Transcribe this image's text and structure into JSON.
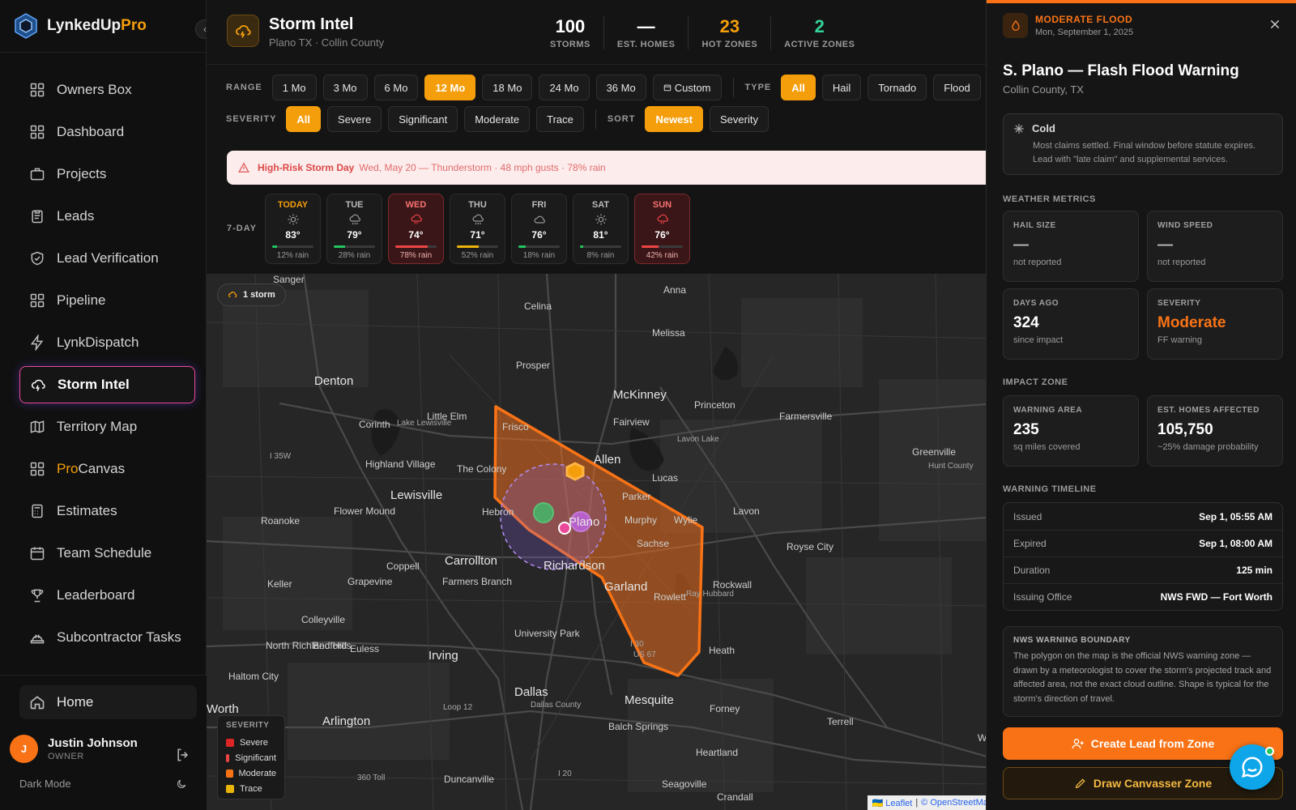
{
  "app": {
    "name_main": "LynkedUp",
    "name_accent": "Pro"
  },
  "sidebar": {
    "items": [
      {
        "label": "Owners Box",
        "icon": "grid-icon"
      },
      {
        "label": "Dashboard",
        "icon": "grid-icon"
      },
      {
        "label": "Projects",
        "icon": "briefcase-icon"
      },
      {
        "label": "Leads",
        "icon": "clipboard-icon"
      },
      {
        "label": "Lead Verification",
        "icon": "shield-check-icon"
      },
      {
        "label": "Pipeline",
        "icon": "grid-icon"
      },
      {
        "label": "LynkDispatch",
        "icon": "bolt-icon"
      },
      {
        "label": "Storm Intel",
        "icon": "storm-cloud-icon",
        "active": true
      },
      {
        "label": "Territory Map",
        "icon": "map-icon"
      },
      {
        "label": "ProCanvas",
        "icon": "grid-icon"
      },
      {
        "label": "Estimates",
        "icon": "calculator-icon"
      },
      {
        "label": "Team Schedule",
        "icon": "calendar-icon"
      },
      {
        "label": "Leaderboard",
        "icon": "trophy-icon"
      },
      {
        "label": "Subcontractor Tasks",
        "icon": "hard-hat-icon"
      }
    ],
    "procanvas_accent": "Pro",
    "procanvas_rest": "Canvas",
    "home": "Home",
    "user": {
      "initial": "J",
      "name": "Justin Johnson",
      "role": "OWNER"
    },
    "dark_mode": "Dark Mode"
  },
  "header": {
    "title": "Storm Intel",
    "subtitle": "Plano TX · Collin County",
    "stats": [
      {
        "value": "100",
        "label": "STORMS",
        "tone": "white"
      },
      {
        "value": "—",
        "label": "EST. HOMES",
        "tone": "white"
      },
      {
        "value": "23",
        "label": "HOT ZONES",
        "tone": "orange"
      },
      {
        "value": "2",
        "label": "ACTIVE ZONES",
        "tone": "green"
      }
    ]
  },
  "filters": {
    "range_label": "RANGE",
    "range": [
      "1 Mo",
      "3 Mo",
      "6 Mo",
      "12 Mo",
      "18 Mo",
      "24 Mo",
      "36 Mo",
      "Custom"
    ],
    "range_selected": "12 Mo",
    "type_label": "TYPE",
    "type": [
      "All",
      "Hail",
      "Tornado",
      "Flood"
    ],
    "type_selected": "All",
    "severity_label": "SEVERITY",
    "severity": [
      "All",
      "Severe",
      "Significant",
      "Moderate",
      "Trace"
    ],
    "severity_selected": "All",
    "sort_label": "SORT",
    "sort": [
      "Newest",
      "Severity"
    ],
    "sort_selected": "Newest"
  },
  "alert": {
    "title": "High-Risk Storm Day",
    "detail": "Wed, May 20 — Thunderstorm · 48 mph gusts · 78% rain"
  },
  "forecast": {
    "label": "7-DAY",
    "days": [
      {
        "day": "TODAY",
        "temp": "83°",
        "rain": "12% rain",
        "rain_pct": 12,
        "icon": "sun-icon",
        "bar": "#22c55e",
        "style": "today"
      },
      {
        "day": "TUE",
        "temp": "79°",
        "rain": "28% rain",
        "rain_pct": 28,
        "icon": "rain-cloud-icon",
        "bar": "#22c55e",
        "style": ""
      },
      {
        "day": "WED",
        "temp": "74°",
        "rain": "78% rain",
        "rain_pct": 78,
        "icon": "storm-cloud-icon",
        "bar": "#ef4444",
        "style": "hot"
      },
      {
        "day": "THU",
        "temp": "71°",
        "rain": "52% rain",
        "rain_pct": 52,
        "icon": "rain-cloud-icon",
        "bar": "#eab308",
        "style": ""
      },
      {
        "day": "FRI",
        "temp": "76°",
        "rain": "18% rain",
        "rain_pct": 18,
        "icon": "cloud-icon",
        "bar": "#22c55e",
        "style": ""
      },
      {
        "day": "SAT",
        "temp": "81°",
        "rain": "8% rain",
        "rain_pct": 8,
        "icon": "sun-icon",
        "bar": "#22c55e",
        "style": ""
      },
      {
        "day": "SUN",
        "temp": "76°",
        "rain": "42% rain",
        "rain_pct": 42,
        "icon": "storm-cloud-icon",
        "bar": "#ef4444",
        "style": "hot"
      }
    ]
  },
  "map": {
    "storm_count": "1 storm",
    "labels": [
      "Sanger",
      "Anna",
      "Celina",
      "Melissa",
      "Prosper",
      "Denton",
      "McKinney",
      "Princeton",
      "Farmersville",
      "Little Elm",
      "Frisco",
      "Fairview",
      "Corinth",
      "Lavon Lake",
      "Lake Lewisville",
      "Allen",
      "I 35W",
      "Highland Village",
      "The Colony",
      "Lucas",
      "Greenville",
      "Hunt County",
      "Lewisville",
      "Parker",
      "Flower Mound",
      "Hebron",
      "Plano",
      "Murphy",
      "Wylie",
      "Lavon",
      "Roanoke",
      "Sachse",
      "Royse City",
      "Carrollton",
      "Coppell",
      "Richardson",
      "Grapevine",
      "Farmers Branch",
      "Rockwall",
      "Keller",
      "Garland",
      "Ray Hubbard",
      "Rowlett",
      "Colleyville",
      "University Park",
      "North Richland Hills",
      "Bedford",
      "Euless",
      "I 30",
      "US 67",
      "Heath",
      "Irving",
      "Haltom City",
      "Dallas",
      "Mesquite",
      "Forney",
      "Loop 12",
      "Dallas County",
      "Worth",
      "Arlington",
      "Balch Springs",
      "Terrell",
      "Wills Point",
      "Heartland",
      "I 20",
      "360 Toll",
      "Duncanville",
      "Seagoville",
      "Crandall"
    ],
    "legend_title": "SEVERITY",
    "legend": [
      {
        "label": "Severe",
        "color": "#dc2626"
      },
      {
        "label": "Significant",
        "color": "#ef4444"
      },
      {
        "label": "Moderate",
        "color": "#f97316"
      },
      {
        "label": "Trace",
        "color": "#eab308"
      }
    ],
    "attribution_leaflet": "Leaflet",
    "attribution_sep": "|",
    "attribution_osm": "© OpenStreetMap"
  },
  "panel": {
    "kind": "MODERATE FLOOD",
    "date": "Mon, September 1, 2025",
    "title": "S. Plano — Flash Flood Warning",
    "subtitle": "Collin County, TX",
    "phase_title": "Cold",
    "phase_desc": "Most claims settled. Final window before statute expires. Lead with \"late claim\" and supplemental services.",
    "weather_metrics_label": "WEATHER METRICS",
    "hail_label": "HAIL SIZE",
    "hail_value": "—",
    "hail_sub": "not reported",
    "wind_label": "WIND SPEED",
    "wind_value": "—",
    "wind_sub": "not reported",
    "days_label": "DAYS AGO",
    "days_value": "324",
    "days_sub": "since impact",
    "severity_label": "SEVERITY",
    "severity_value": "Moderate",
    "severity_sub": "FF warning",
    "impact_label": "IMPACT ZONE",
    "area_label": "WARNING AREA",
    "area_value": "235",
    "area_sub": "sq miles covered",
    "homes_label": "EST. HOMES AFFECTED",
    "homes_value": "105,750",
    "homes_sub": "~25% damage probability",
    "timeline_label": "WARNING TIMELINE",
    "timeline": [
      {
        "k": "Issued",
        "v": "Sep 1, 05:55 AM"
      },
      {
        "k": "Expired",
        "v": "Sep 1, 08:00 AM"
      },
      {
        "k": "Duration",
        "v": "125 min"
      },
      {
        "k": "Issuing Office",
        "v": "NWS FWD — Fort Worth"
      }
    ],
    "nws_title": "NWS WARNING BOUNDARY",
    "nws_desc": "The polygon on the map is the official NWS warning zone — drawn by a meteorologist to cover the storm's projected track and affected area, not the exact cloud outline. Shape is typical for the storm's direction of travel.",
    "create_lead": "Create Lead from Zone",
    "draw_zone": "Draw Canvasser Zone"
  },
  "colors": {
    "accent": "#f59e0b",
    "orange": "#f97316",
    "active_border": "#ec4899",
    "green": "#34d399"
  }
}
